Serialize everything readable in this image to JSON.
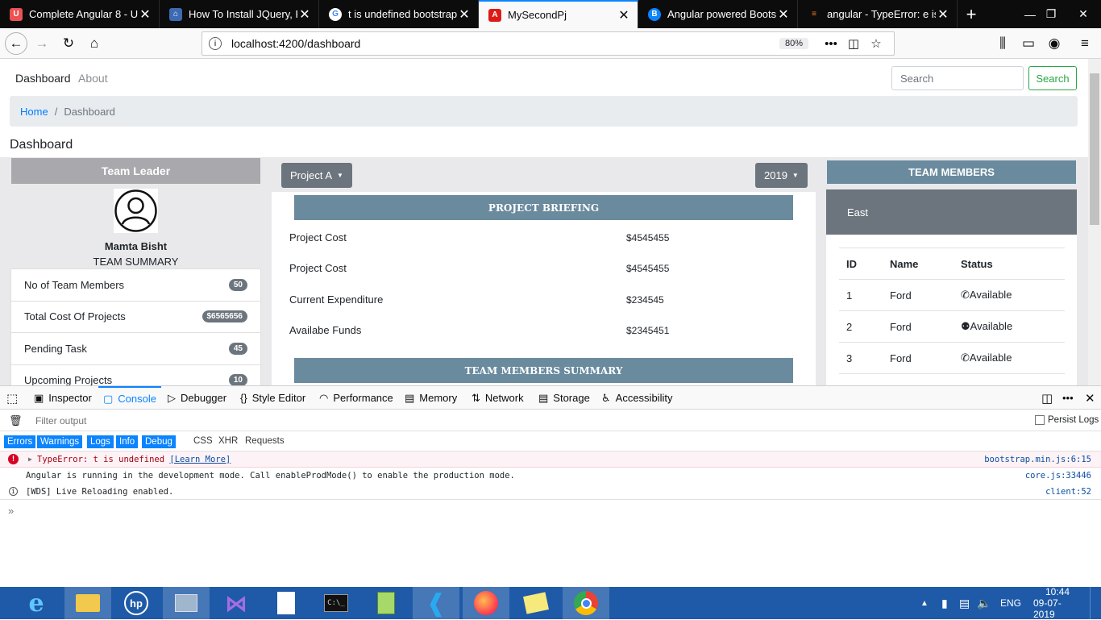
{
  "browser": {
    "tabs": [
      {
        "title": "Complete Angular 8 - Ultimate"
      },
      {
        "title": "How To Install JQuery, Popper"
      },
      {
        "title": "t is undefined bootstrap 4"
      },
      {
        "title": "MySecondPj"
      },
      {
        "title": "Angular powered Bootstrap"
      },
      {
        "title": "angular - TypeError: e is undefined"
      }
    ],
    "url": "localhost:4200/dashboard",
    "zoom": "80%"
  },
  "page": {
    "nav": {
      "dashboard": "Dashboard",
      "about": "About"
    },
    "search": {
      "placeholder": "Search",
      "button": "Search"
    },
    "breadcrumb": {
      "home": "Home",
      "sep": "/",
      "current": "Dashboard"
    },
    "title": "Dashboard",
    "team_leader": {
      "heading": "Team Leader",
      "name": "Mamta Bisht",
      "subtitle": "TEAM SUMMARY",
      "items": [
        {
          "label": "No of Team Members",
          "badge": "50"
        },
        {
          "label": "Total Cost Of Projects",
          "badge": "$6565656"
        },
        {
          "label": "Pending Task",
          "badge": "45"
        },
        {
          "label": "Upcoming Projects",
          "badge": "10"
        }
      ]
    },
    "project": {
      "dropdown": "Project A",
      "year": "2019",
      "briefing_title": "PROJECT BRIEFING",
      "rows": [
        {
          "label": "Project Cost",
          "value": "$4545455"
        },
        {
          "label": "Project Cost",
          "value": "$4545455"
        },
        {
          "label": "Current Expenditure",
          "value": "$234545"
        },
        {
          "label": "Availabe Funds",
          "value": "$2345451"
        }
      ],
      "members_summary_title": "TEAM MEMBERS SUMMARY"
    },
    "team_members": {
      "heading": "TEAM MEMBERS",
      "region": "East",
      "columns": [
        "ID",
        "Name",
        "Status"
      ],
      "rows": [
        {
          "id": "1",
          "name": "Ford",
          "status": "Available"
        },
        {
          "id": "2",
          "name": "Ford",
          "status": "Available"
        },
        {
          "id": "3",
          "name": "Ford",
          "status": "Available"
        }
      ]
    }
  },
  "devtools": {
    "tabs": [
      "Inspector",
      "Console",
      "Debugger",
      "Style Editor",
      "Performance",
      "Memory",
      "Network",
      "Storage",
      "Accessibility"
    ],
    "filter_placeholder": "Filter output",
    "persist_logs": "Persist Logs",
    "levels": [
      "Errors",
      "Warnings",
      "Logs",
      "Info",
      "Debug"
    ],
    "filters": [
      "CSS",
      "XHR",
      "Requests"
    ],
    "logs": [
      {
        "type": "error",
        "text": "TypeError: t is undefined",
        "link": "[Learn More]",
        "source": "bootstrap.min.js:6:15"
      },
      {
        "type": "log",
        "text": "Angular is running in the development mode. Call enableProdMode() to enable the production mode.",
        "source": "core.js:33446"
      },
      {
        "type": "info",
        "text": "[WDS] Live Reloading enabled.",
        "source": "client:52"
      }
    ]
  },
  "taskbar": {
    "lang": "ENG",
    "time": "10:44",
    "date": "09-07-2019"
  }
}
